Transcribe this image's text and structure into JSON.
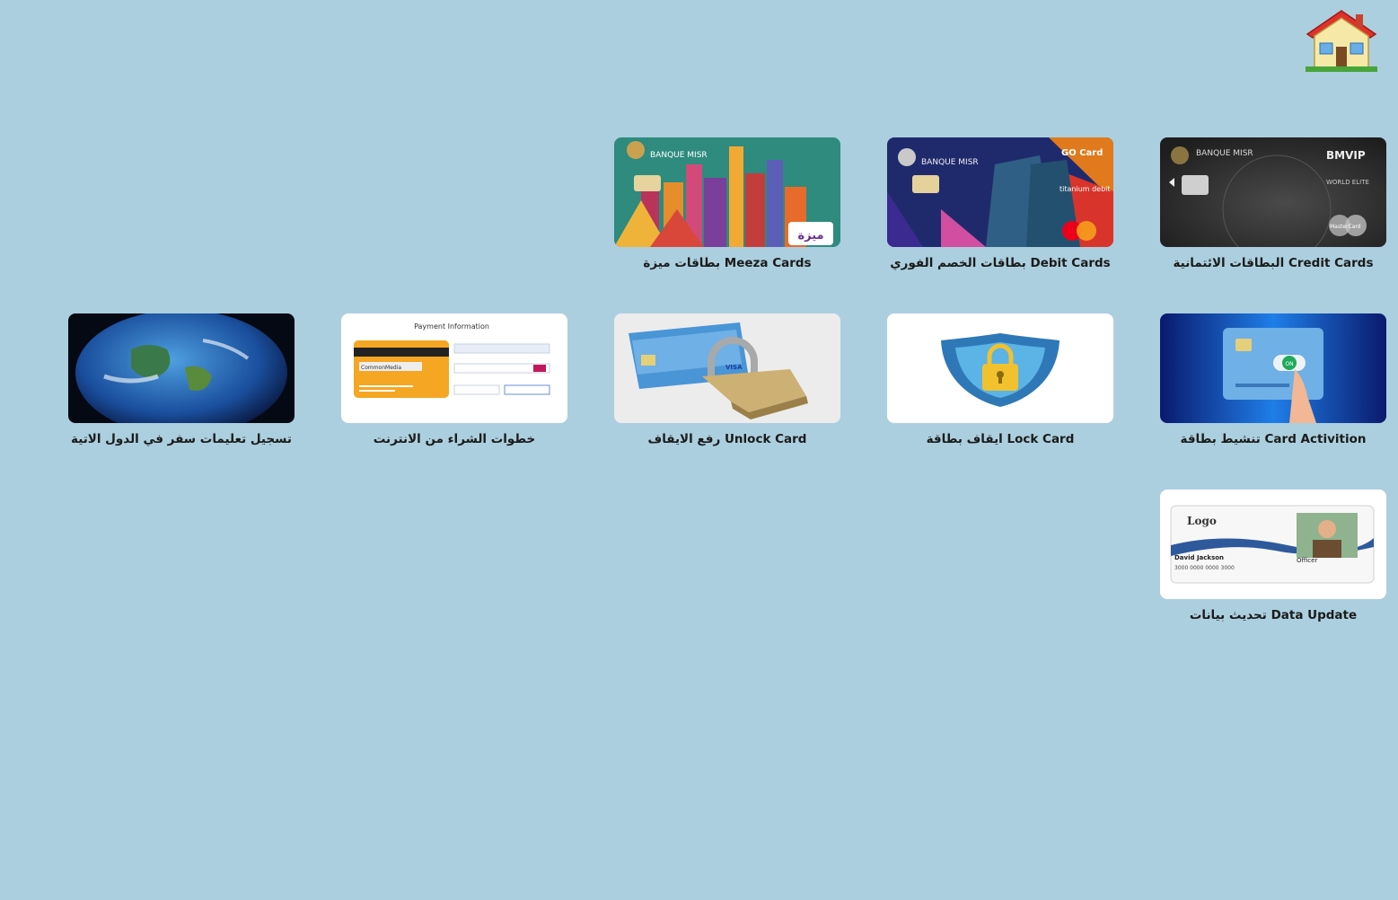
{
  "header": {
    "home_icon": "home-house-icon"
  },
  "tiles": [
    {
      "id": "credit",
      "label": "Credit Cards البطاقات الائتمانية",
      "brand_text": "BANQUE MISR",
      "card_text": "WORLD ELITE",
      "card_tier": "BMVIP",
      "network": "MasterCard",
      "icon": "credit-card-image"
    },
    {
      "id": "debit",
      "label": "Debit Cards بطاقات الخصم الفوري",
      "brand_text": "BANQUE MISR",
      "card_text": "titanium debit",
      "card_tier": "GO Card",
      "icon": "debit-card-image"
    },
    {
      "id": "meeza",
      "label": "Meeza Cards بطاقات ميزة",
      "brand_text": "BANQUE MISR",
      "card_tier": "ميزة",
      "icon": "meeza-card-image"
    },
    {
      "id": "activation",
      "label": "Card Activition تنشيط بطاقة",
      "toggle_text": "ON",
      "icon": "card-activation-image"
    },
    {
      "id": "lock",
      "label": "Lock Card ايقاف بطاقة",
      "icon": "shield-lock-icon"
    },
    {
      "id": "unlock",
      "label": "Unlock Card رفع الايقاف",
      "network": "VISA",
      "icon": "card-padlock-image"
    },
    {
      "id": "online",
      "label": "خطوات الشراء من الانترنت",
      "heading": "Payment Information",
      "cvv_text": "CommonMedia",
      "icon": "payment-info-image"
    },
    {
      "id": "travel",
      "label": "تسجيل تعليمات سفر في الدول الاتية",
      "icon": "earth-globe-image"
    },
    {
      "id": "update",
      "label": "Data Update تحديث بيانات",
      "id_logo": "Logo",
      "id_name": "David Jackson",
      "id_role": "Officer",
      "id_number": "3000 0000 0000 3000",
      "icon": "id-card-image"
    }
  ]
}
